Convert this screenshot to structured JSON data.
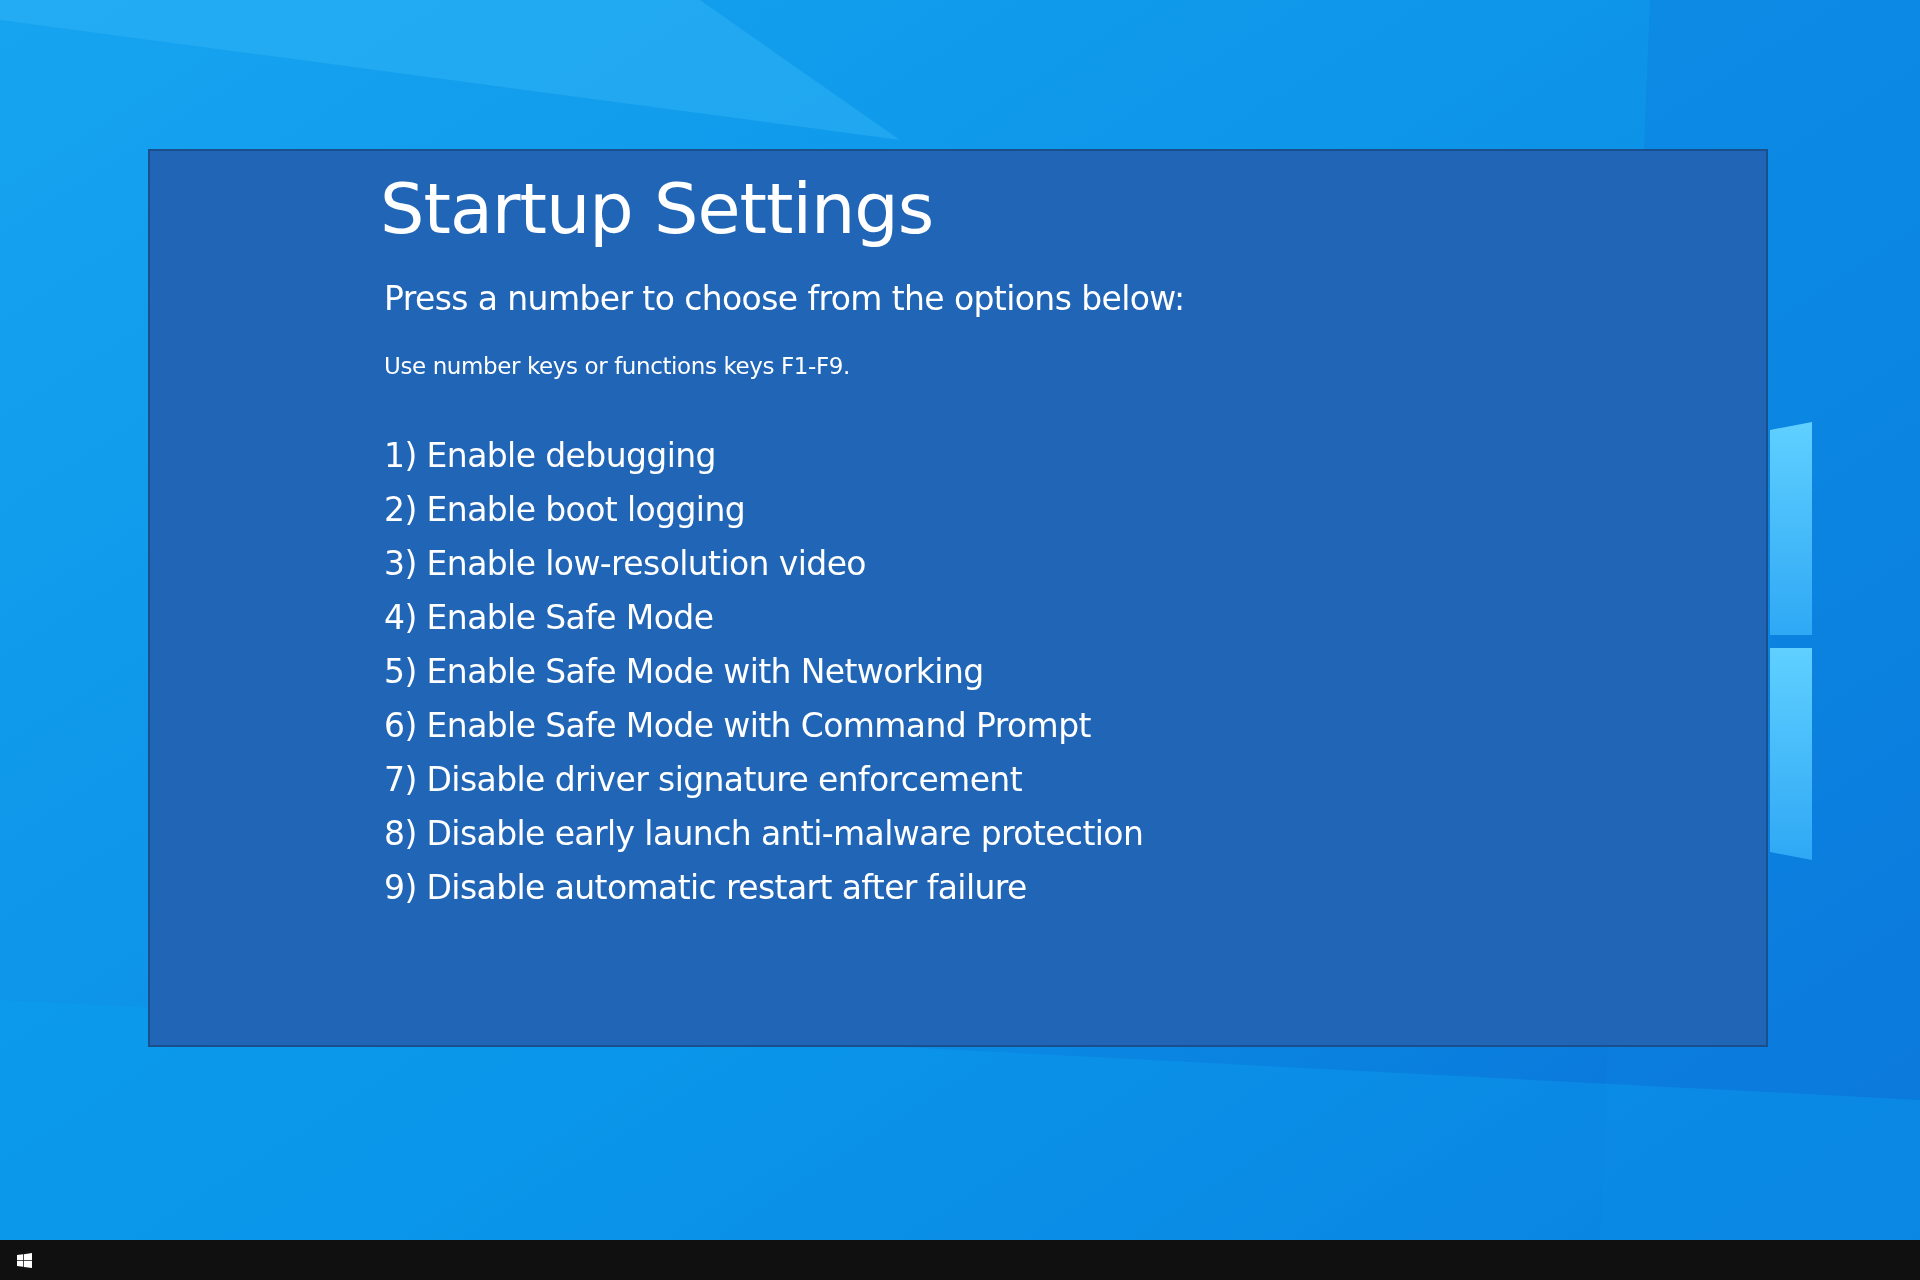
{
  "startup_settings": {
    "title": "Startup Settings",
    "prompt": "Press a number to choose from the options below:",
    "hint": "Use number keys or functions keys F1-F9.",
    "options": [
      "1) Enable debugging",
      "2) Enable boot logging",
      "3) Enable low-resolution video",
      "4) Enable Safe Mode",
      "5) Enable Safe Mode with Networking",
      "6) Enable Safe Mode with Command Prompt",
      "7) Disable driver signature enforcement",
      "8) Disable early launch anti-malware protection",
      "9) Disable automatic restart after failure"
    ]
  }
}
